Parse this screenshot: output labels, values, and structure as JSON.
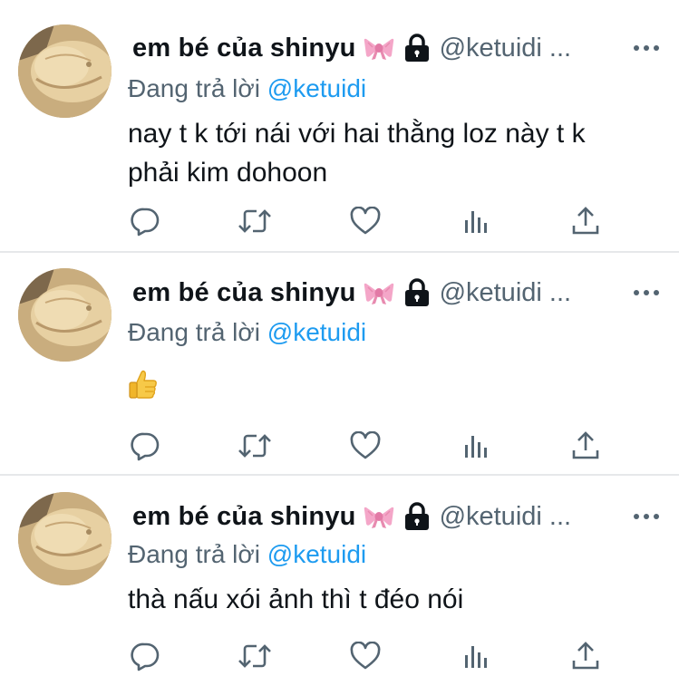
{
  "tweets": [
    {
      "display_name": "em bé của shinyu",
      "name_emoji": "ribbon-emoji",
      "lock_emoji": "lock-emoji",
      "handle": "@ketuidi ...",
      "reply_prefix": "Đang trả lời",
      "reply_to": "@ketuidi",
      "text_lines": [
        "nay t k tới nái với hai thằng loz này t k",
        "phải kim dohoon"
      ]
    },
    {
      "display_name": "em bé của shinyu",
      "name_emoji": "ribbon-emoji",
      "lock_emoji": "lock-emoji",
      "handle": "@ketuidi ...",
      "reply_prefix": "Đang trả lời",
      "reply_to": "@ketuidi",
      "text_emoji": "thumbs-up-emoji"
    },
    {
      "display_name": "em bé của shinyu",
      "name_emoji": "ribbon-emoji",
      "lock_emoji": "lock-emoji",
      "handle": "@ketuidi ...",
      "reply_prefix": "Đang trả lời",
      "reply_to": "@ketuidi",
      "text_lines": [
        "thà nấu xói ảnh thì t đéo nói"
      ]
    }
  ],
  "icons": {
    "reply": "reply-icon",
    "retweet": "retweet-icon",
    "like": "heart-icon",
    "views": "views-icon",
    "share": "share-icon",
    "more": "more-icon"
  },
  "colors": {
    "text": "#0f1419",
    "secondary": "#536471",
    "link": "#1d9bf0",
    "ribbon": "#f4a6c8",
    "divider": "#e6e8ea"
  }
}
